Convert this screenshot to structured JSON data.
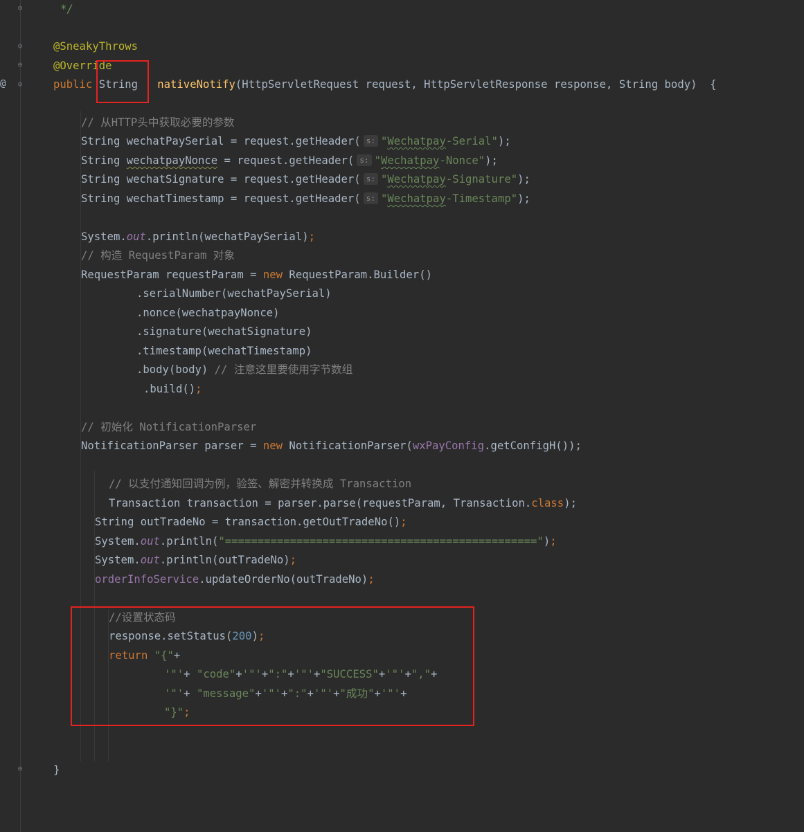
{
  "editor": {
    "language": "Java",
    "theme_colors": {
      "background": "#2b2b2b",
      "keyword": "#cc7832",
      "string": "#6a8759",
      "comment": "#808080",
      "annotation": "#bbb529",
      "method_decl": "#ffc66d",
      "field": "#9876aa",
      "number": "#6897bb",
      "highlight_box": "#e5231f"
    },
    "param_hint_label": "s:",
    "lines": {
      "doc_end": "*/",
      "ann_sneaky": "@SneakyThrows",
      "ann_override": "@Override",
      "sig_public": "public",
      "sig_string": "String",
      "sig_method": "nativeNotify",
      "sig_params": "(HttpServletRequest request, HttpServletResponse response, String body)  {",
      "c_get_headers": "// 从HTTP头中获取必要的参数",
      "serial_pre": "String wechatPaySerial = request.getHeader(",
      "serial_str_a": "\"",
      "serial_str_b": "Wechatpay",
      "serial_str_c": "-Serial\"",
      "serial_end": ");",
      "nonce_pre_a": "String ",
      "nonce_var": "wechatpayNonce",
      "nonce_pre_b": " = request.getHeader(",
      "nonce_str_a": "\"",
      "nonce_str_b": "Wechatpay",
      "nonce_str_c": "-Nonce\"",
      "nonce_end": ");",
      "sig_pre": "String wechatSignature = request.getHeader(",
      "sig_str_a": "\"",
      "sig_str_b": "Wechatpay",
      "sig_str_c": "-Signature\"",
      "sig_end": ");",
      "ts_pre": "String wechatTimestamp = request.getHeader(",
      "ts_str_a": "\"",
      "ts_str_b": "Wechatpay",
      "ts_str_c": "-Timestamp\"",
      "ts_end": ");",
      "print1_a": "System.",
      "print1_out": "out",
      "print1_b": ".println(wechatPaySerial)",
      "semicolon": ";",
      "c_build_param": "// 构造 RequestParam 对象",
      "rp_a": "RequestParam requestParam = ",
      "rp_new": "new",
      "rp_b": " RequestParam.Builder()",
      "b_serial": ".serialNumber(wechatPaySerial)",
      "b_nonce": ".nonce(wechatpayNonce)",
      "b_signature": ".signature(wechatSignature)",
      "b_timestamp": ".timestamp(wechatTimestamp)",
      "b_body": ".body(body) ",
      "b_body_cmt": "// 注意这里要使用字节数组",
      "b_build": ".build()",
      "c_init_parser": "// 初始化 NotificationParser",
      "np_a": "NotificationParser parser = ",
      "np_new": "new",
      "np_b": " NotificationParser(",
      "np_cfg": "wxPayConfig",
      "np_c": ".getConfigH());",
      "c_verify": "// 以支付通知回调为例，验签、解密并转换成 Transaction",
      "tx_a": "Transaction transaction = parser.parse(requestParam, Transaction.",
      "tx_class": "class",
      "tx_end": ");",
      "otn": "String outTradeNo = transaction.getOutTradeNo()",
      "print2_a": "System.",
      "print2_out": "out",
      "print2_b": ".println(",
      "print2_str": "\"================================================\"",
      "print2_end": ")",
      "print3_a": "System.",
      "print3_out": "out",
      "print3_b": ".println(outTradeNo)",
      "upd_svc": "orderInfoService",
      "upd_b": ".updateOrderNo(outTradeNo)",
      "c_status": "//设置状态码",
      "st_a": "response.setStatus(",
      "st_num": "200",
      "st_b": ")",
      "ret_kw": "return",
      "ret_str": " \"{\"",
      "ret_plus": "+",
      "r1_s1": "'\"'",
      "r1_p1": "+ ",
      "r1_s2": "\"code\"",
      "r1_p2": "+",
      "r1_s3": "'\"'",
      "r1_p3": "+",
      "r1_s4": "\":\"",
      "r1_p4": "+",
      "r1_s5": "'\"'",
      "r1_p5": "+",
      "r1_s6": "\"SUCCESS\"",
      "r1_p6": "+",
      "r1_s7": "'\"'",
      "r1_p7": "+",
      "r1_s8": "\",\"",
      "r1_p8": "+",
      "r2_s1": "'\"'",
      "r2_p1": "+ ",
      "r2_s2": "\"message\"",
      "r2_p2": "+",
      "r2_s3": "'\"'",
      "r2_p3": "+",
      "r2_s4": "\":\"",
      "r2_p4": "+",
      "r2_s5": "'\"'",
      "r2_p5": "+",
      "r2_s6": "\"成功\"",
      "r2_p6": "+",
      "r2_s7": "'\"'",
      "r2_p7": "+",
      "r3_str": "\"}\"",
      "r3_end": ";",
      "close_brace": "}"
    },
    "gutter_marker": "@"
  }
}
